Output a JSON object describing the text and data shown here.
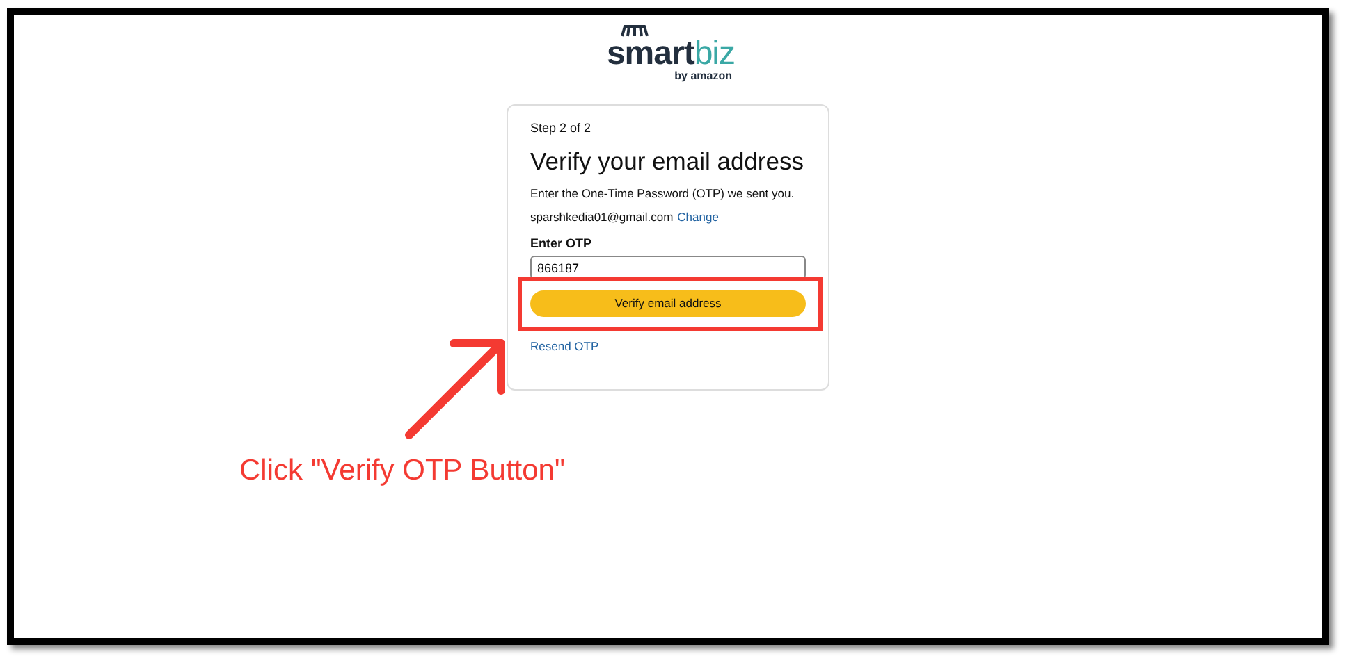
{
  "logo": {
    "wordmark_dark": "smart",
    "wordmark_light": "biz",
    "tagline": "by amazon"
  },
  "card": {
    "step": "Step 2 of 2",
    "title": "Verify your email address",
    "instruction": "Enter the One-Time Password (OTP) we sent you.",
    "email": "sparshkedia01@gmail.com",
    "change_link": "Change",
    "otp_label": "Enter OTP",
    "otp_value": "866187",
    "verify_button": "Verify email address",
    "resend_link": "Resend OTP"
  },
  "annotation": {
    "caption": "Click \"Verify OTP Button\""
  }
}
